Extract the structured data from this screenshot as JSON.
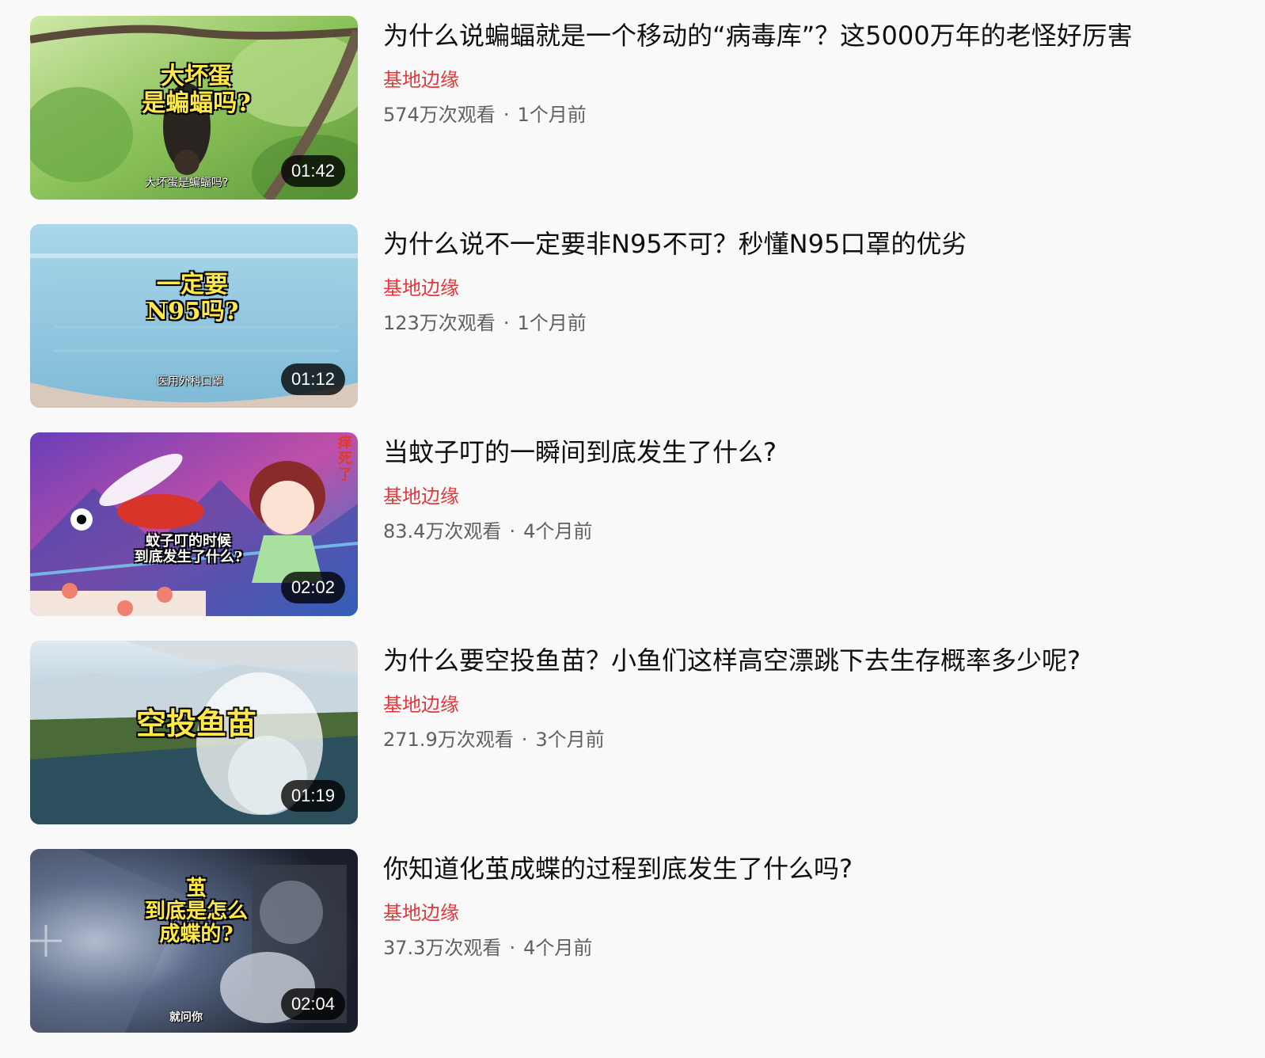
{
  "videos": [
    {
      "title": "为什么说蝙蝠就是一个移动的“病毒库”？这5000万年的老怪好厉害",
      "channel": "基地边缘",
      "views": "574万次观看",
      "age": "1个月前",
      "duration": "01:42",
      "thumb_caption": "大坏蛋\n是蝙蝠吗?",
      "thumb_subtitle": "大坏蛋是蝙蝠吗?"
    },
    {
      "title": "为什么说不一定要非N95不可？秒懂N95口罩的优劣",
      "channel": "基地边缘",
      "views": "123万次观看",
      "age": "1个月前",
      "duration": "01:12",
      "thumb_caption": "一定要\nN95吗?",
      "thumb_subtitle": "医用外科口罩"
    },
    {
      "title": "当蚊子叮的一瞬间到底发生了什么?",
      "channel": "基地边缘",
      "views": "83.4万次观看",
      "age": "4个月前",
      "duration": "02:02",
      "thumb_caption": "蚊子叮的时候\n到底发生了什么?",
      "thumb_corner": "痒死了"
    },
    {
      "title": "为什么要空投鱼苗？小鱼们这样高空漂跳下去生存概率多少呢?",
      "channel": "基地边缘",
      "views": "271.9万次观看",
      "age": "3个月前",
      "duration": "01:19",
      "thumb_caption": "空投鱼苗"
    },
    {
      "title": "你知道化茧成蝶的过程到底发生了什么吗?",
      "channel": "基地边缘",
      "views": "37.3万次观看",
      "age": "4个月前",
      "duration": "02:04",
      "thumb_caption": "茧\n到底是怎么\n成蝶的?",
      "thumb_subtitle": "就问你"
    }
  ],
  "separator": "·",
  "colors": {
    "channel": "#e5373b",
    "meta": "#606060",
    "title": "#0f0f0f",
    "background": "#f9f9f9"
  }
}
